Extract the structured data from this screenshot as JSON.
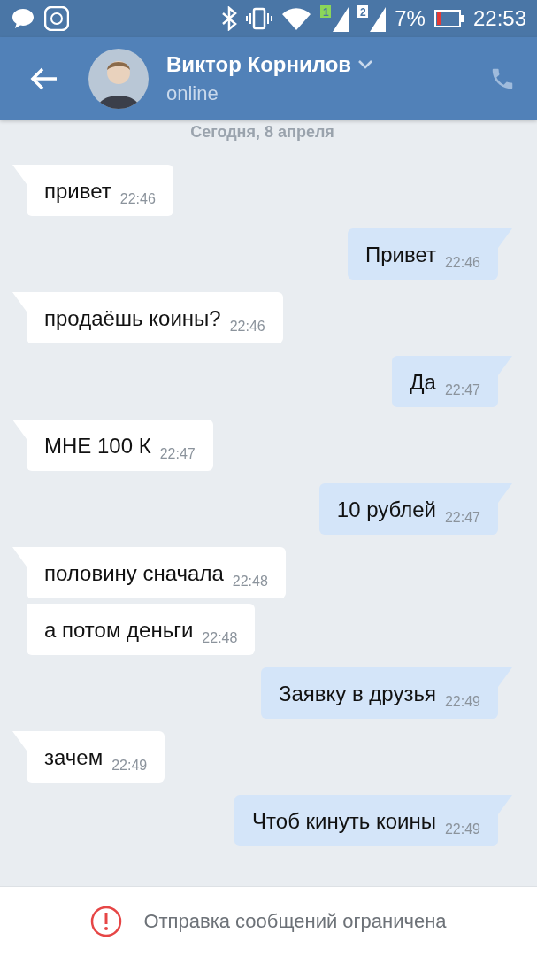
{
  "status_bar": {
    "battery_text": "7%",
    "time": "22:53",
    "sim_labels": [
      "1",
      "2"
    ]
  },
  "header": {
    "name": "Виктор Корнилов",
    "status": "online"
  },
  "date_label": "Сегодня, 8 апреля",
  "messages": [
    {
      "kind": "incoming",
      "text": "привет",
      "time": "22:46",
      "tail": true
    },
    {
      "kind": "outgoing",
      "text": "Привет",
      "time": "22:46",
      "tail": true
    },
    {
      "kind": "incoming",
      "text": "продаёшь коины?",
      "time": "22:46",
      "tail": true
    },
    {
      "kind": "outgoing",
      "text": "Да",
      "time": "22:47",
      "tail": true
    },
    {
      "kind": "incoming",
      "text": "МНЕ 100 К",
      "time": "22:47",
      "tail": true
    },
    {
      "kind": "outgoing",
      "text": "10 рублей",
      "time": "22:47",
      "tail": true
    },
    {
      "kind": "incoming",
      "text": "половину сначала",
      "time": "22:48",
      "tail": true
    },
    {
      "kind": "incoming",
      "text": "а потом деньги",
      "time": "22:48",
      "tail": false
    },
    {
      "kind": "outgoing",
      "text": "Заявку в друзья",
      "time": "22:49",
      "tail": true
    },
    {
      "kind": "incoming",
      "text": "зачем",
      "time": "22:49",
      "tail": true
    },
    {
      "kind": "outgoing",
      "text": "Чтоб кинуть коины",
      "time": "22:49",
      "tail": true
    }
  ],
  "restriction": {
    "text": "Отправка сообщений ограничена"
  }
}
